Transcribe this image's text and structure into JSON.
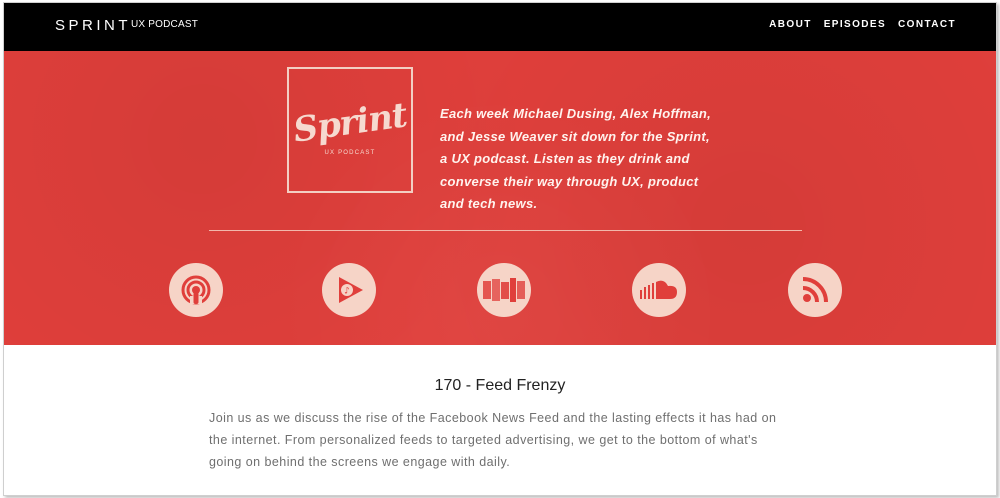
{
  "nav": {
    "brand": "SPRINT",
    "brand_sub": "UX PODCAST",
    "links": [
      "ABOUT",
      "EPISODES",
      "CONTACT"
    ]
  },
  "hero": {
    "logo_text": "Sprint",
    "logo_sub": "UX PODCAST",
    "tagline_lines": [
      "Each week Michael Dusing, Alex Hoffman,",
      "and Jesse Weaver sit down for the Sprint,",
      "a UX podcast. Listen as they drink and",
      "converse their way through UX, product",
      "and tech news."
    ],
    "icons": [
      "apple-podcasts-icon",
      "google-play-music-icon",
      "stitcher-icon",
      "soundcloud-icon",
      "rss-feed-icon"
    ]
  },
  "episode": {
    "title": "170 - Feed Frenzy",
    "description_lines": [
      "Join us as we discuss the rise of the Facebook News Feed and the lasting effects it has had on",
      "the internet. From personalized feeds to targeted advertising, we get to the bottom of what's",
      "going on behind the screens we engage with daily."
    ]
  },
  "colors": {
    "nav_bg": "#000000",
    "hero_bg": "#e03f3b",
    "icon_bg": "#f6d4c7",
    "text_dark": "#222222",
    "text_muted": "#6f6f6f"
  }
}
